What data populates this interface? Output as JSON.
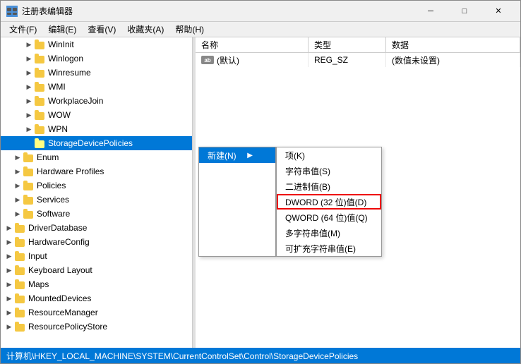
{
  "titlebar": {
    "title": "注册表编辑器",
    "minimize": "─",
    "maximize": "□",
    "close": "✕"
  },
  "menubar": {
    "items": [
      "文件(F)",
      "编辑(E)",
      "查看(V)",
      "收藏夹(A)",
      "帮助(H)"
    ]
  },
  "tree": {
    "items": [
      {
        "label": "WinInit",
        "depth": 3,
        "state": "collapsed"
      },
      {
        "label": "Winlogon",
        "depth": 3,
        "state": "collapsed"
      },
      {
        "label": "Winresume",
        "depth": 3,
        "state": "collapsed"
      },
      {
        "label": "WMI",
        "depth": 3,
        "state": "collapsed"
      },
      {
        "label": "WorkplaceJoin",
        "depth": 3,
        "state": "collapsed"
      },
      {
        "label": "WOW",
        "depth": 3,
        "state": "collapsed"
      },
      {
        "label": "WPN",
        "depth": 3,
        "state": "collapsed"
      },
      {
        "label": "StorageDevicePolicies",
        "depth": 3,
        "state": "selected"
      },
      {
        "label": "Enum",
        "depth": 2,
        "state": "collapsed"
      },
      {
        "label": "Hardware Profiles",
        "depth": 2,
        "state": "collapsed"
      },
      {
        "label": "Policies",
        "depth": 2,
        "state": "collapsed"
      },
      {
        "label": "Services",
        "depth": 2,
        "state": "collapsed"
      },
      {
        "label": "Software",
        "depth": 2,
        "state": "collapsed"
      },
      {
        "label": "DriverDatabase",
        "depth": 1,
        "state": "collapsed"
      },
      {
        "label": "HardwareConfig",
        "depth": 1,
        "state": "collapsed"
      },
      {
        "label": "Input",
        "depth": 1,
        "state": "collapsed"
      },
      {
        "label": "Keyboard Layout",
        "depth": 1,
        "state": "collapsed"
      },
      {
        "label": "Maps",
        "depth": 1,
        "state": "collapsed"
      },
      {
        "label": "MountedDevices",
        "depth": 1,
        "state": "collapsed"
      },
      {
        "label": "ResourceManager",
        "depth": 1,
        "state": "collapsed"
      },
      {
        "label": "ResourcePolicyStore",
        "depth": 1,
        "state": "collapsed"
      }
    ]
  },
  "table": {
    "headers": [
      "名称",
      "类型",
      "数据"
    ],
    "rows": [
      {
        "name": "(默认)",
        "type": "REG_SZ",
        "data": "(数值未设置)",
        "icon": "ab"
      }
    ]
  },
  "context_menu": {
    "main_label": "新建(N)",
    "arrow": "▶",
    "items": [
      "项(K)",
      "字符串值(S)",
      "二进制值(B)",
      "DWORD (32 位)值(D)",
      "QWORD (64 位)值(Q)",
      "多字符串值(M)",
      "可扩充字符串值(E)"
    ]
  },
  "statusbar": {
    "path": "计算机\\HKEY_LOCAL_MACHINE\\SYSTEM\\CurrentControlSet\\Control\\StorageDevicePolicies"
  }
}
